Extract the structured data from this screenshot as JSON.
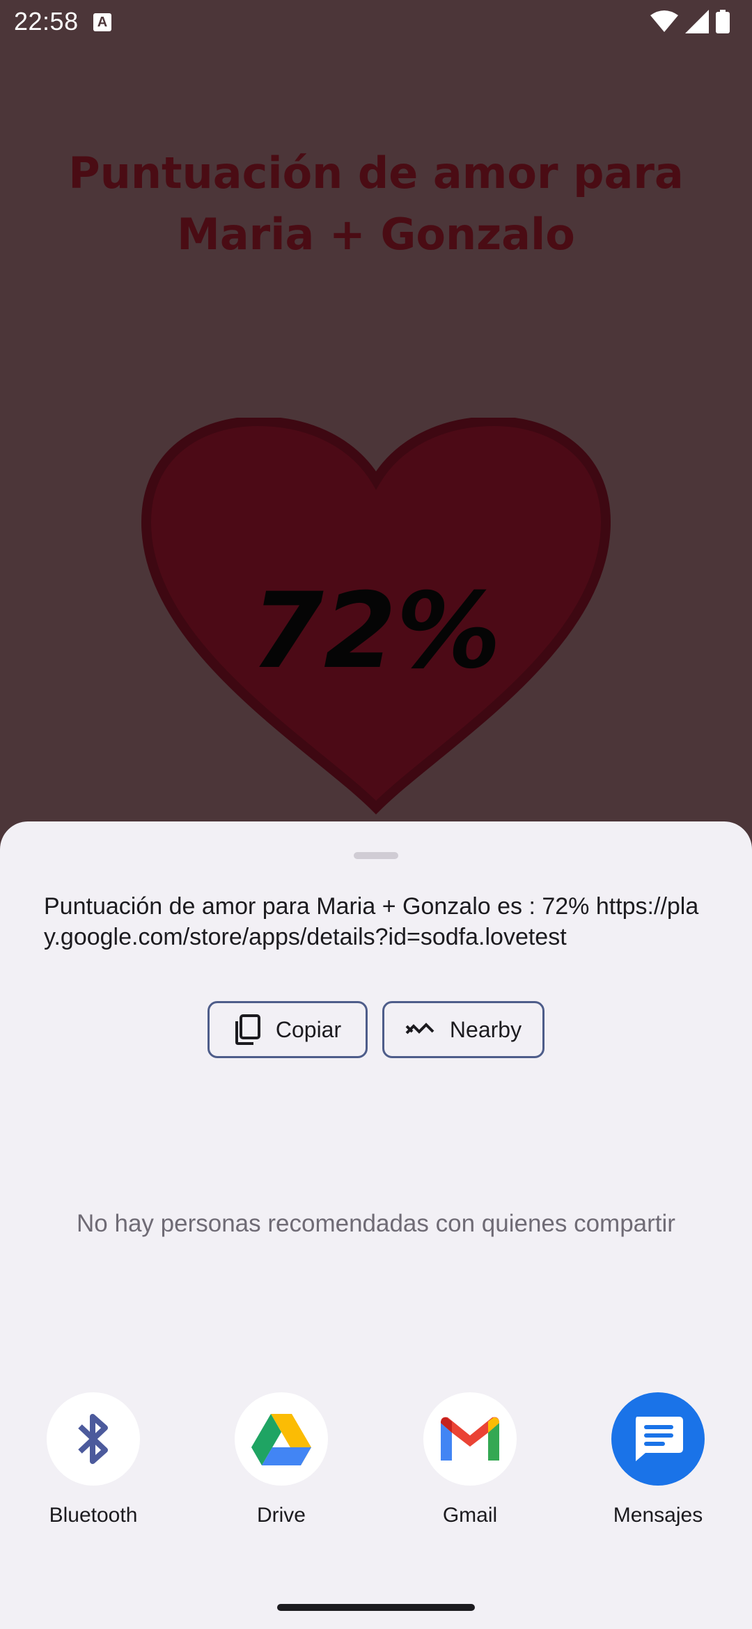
{
  "status_bar": {
    "time": "22:58",
    "notification_icon": "A"
  },
  "app": {
    "title": "Puntuación de amor para Maria + Gonzalo",
    "percent": "72%"
  },
  "share_sheet": {
    "text": "Puntuación de amor para Maria + Gonzalo es : 72% https://play.google.com/store/apps/details?id=sodfa.lovetest",
    "actions": [
      {
        "label": "Copiar",
        "icon": "copy-icon"
      },
      {
        "label": "Nearby",
        "icon": "nearby-icon"
      }
    ],
    "empty_message": "No hay personas recomendadas con quienes compartir",
    "targets": [
      {
        "label": "Bluetooth",
        "icon": "bluetooth-icon"
      },
      {
        "label": "Drive",
        "icon": "drive-icon"
      },
      {
        "label": "Gmail",
        "icon": "gmail-icon"
      },
      {
        "label": "Mensajes",
        "icon": "messages-icon"
      }
    ]
  },
  "colors": {
    "dim_background": "#4c3639",
    "heart": "#4c0a16",
    "sheet": "#f2f0f5",
    "accent": "#1a73e8"
  }
}
